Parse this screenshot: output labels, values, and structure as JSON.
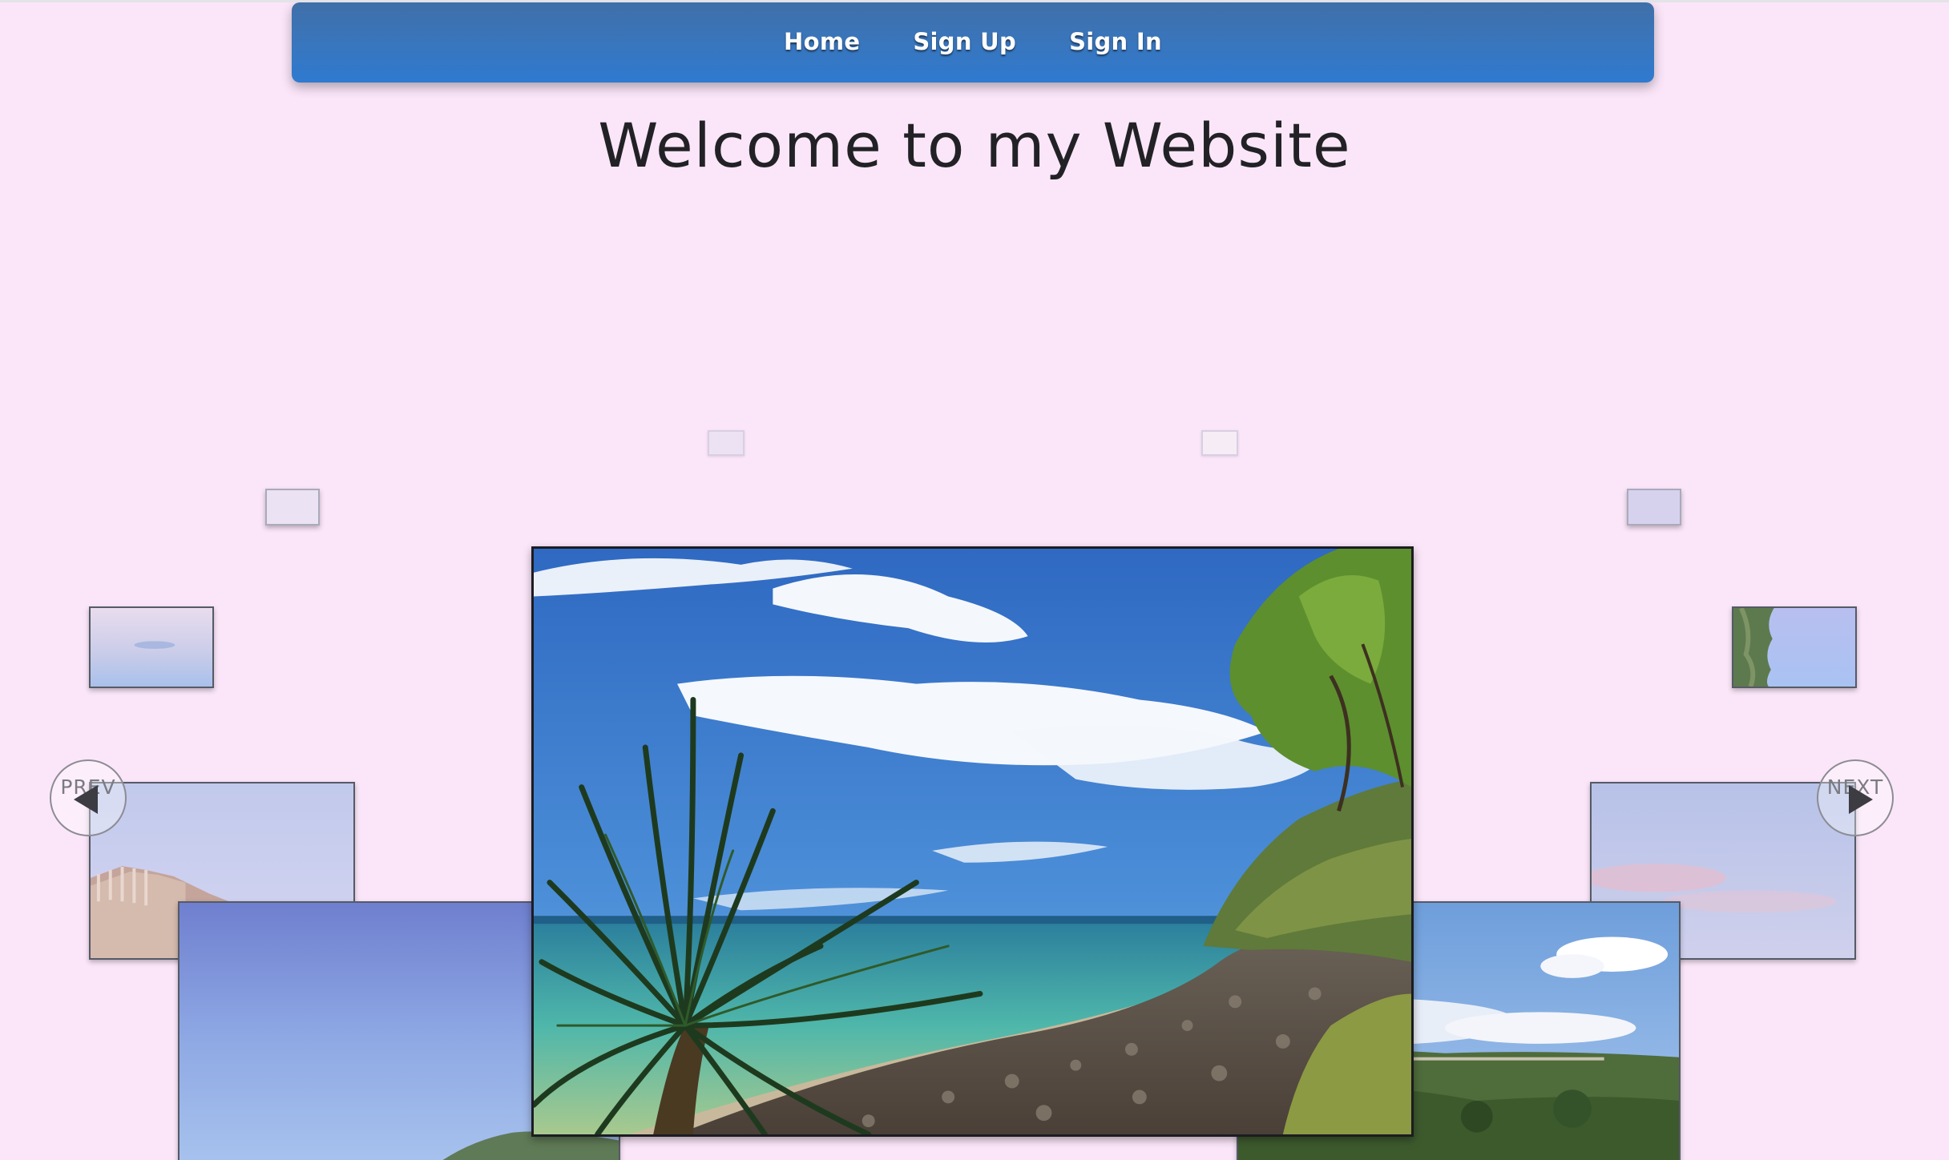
{
  "nav": {
    "items": [
      {
        "label": "Home"
      },
      {
        "label": "Sign Up"
      },
      {
        "label": "Sign In"
      }
    ]
  },
  "page": {
    "title": "Welcome to my Website"
  },
  "carousel": {
    "prev_label": "PREV",
    "next_label": "NEXT",
    "slides": [
      {
        "subject": "beach with pandanus palm, turquoise sea and rocky shore",
        "position": "center"
      },
      {
        "subject": "blue sky over headland",
        "position": "near-left"
      },
      {
        "subject": "sky with clouds over green hills and road",
        "position": "near-right"
      },
      {
        "subject": "sky over sandstone cliff",
        "position": "left"
      },
      {
        "subject": "pale sky with pink clouds",
        "position": "right"
      },
      {
        "subject": "pale sky",
        "position": "far-left"
      },
      {
        "subject": "trees against blue sky",
        "position": "far-right"
      }
    ]
  },
  "colors": {
    "background": "#fbe6f9",
    "navbar": "#3575c0",
    "title_text": "#222226"
  }
}
